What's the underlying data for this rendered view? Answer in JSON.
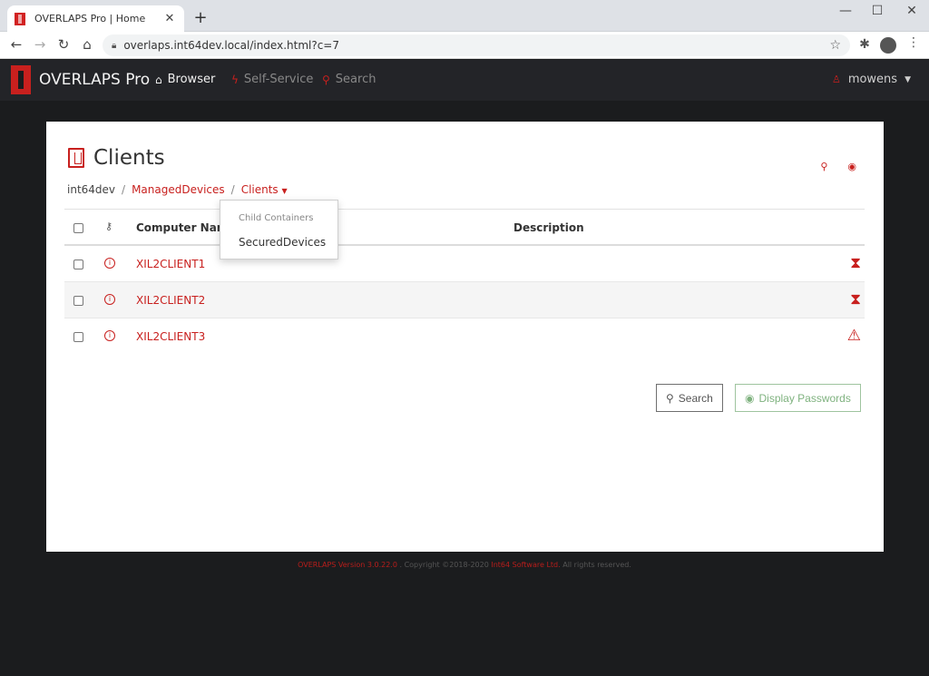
{
  "browser": {
    "tab_title": "OVERLAPS Pro | Home",
    "tab_close": "✕",
    "new_tab": "+",
    "url": "overlaps.int64dev.local/index.html?c=7",
    "window_controls": {
      "minimize": "—",
      "maximize": "☐",
      "close": "✕"
    }
  },
  "navbar": {
    "brand": "OVERLAPS Pro",
    "items": [
      {
        "label": "Browser",
        "icon": "home-icon"
      },
      {
        "label": "Self-Service",
        "icon": "bolt-icon"
      },
      {
        "label": "Search",
        "icon": "search-icon"
      }
    ],
    "user": "mowens"
  },
  "page": {
    "title": "Clients",
    "breadcrumb": {
      "root": "int64dev",
      "sep": "/",
      "items": [
        "ManagedDevices",
        "Clients"
      ]
    },
    "table": {
      "headers": {
        "computer_name": "Computer Name",
        "description": "Description"
      },
      "rows": [
        {
          "name": "XIL2CLIENT1",
          "description": "",
          "status": "hourglass-icon"
        },
        {
          "name": "XIL2CLIENT2",
          "description": "",
          "status": "hourglass-icon"
        },
        {
          "name": "XIL2CLIENT3",
          "description": "",
          "status": "warning-icon"
        }
      ]
    },
    "buttons": {
      "search": "Search",
      "display_passwords": "Display Passwords"
    },
    "dropdown": {
      "header": "Child Containers",
      "items": [
        "SecuredDevices"
      ]
    }
  },
  "footer": {
    "version": "OVERLAPS Version 3.0.22.0",
    "copyright": ". Copyright ©2018-2020",
    "company": "Int64 Software Ltd.",
    "rights": "All rights reserved."
  },
  "colors": {
    "accent": "#c8201e",
    "success": "#7fb27f",
    "navbar": "#232428",
    "background": "#1b1c1e"
  }
}
